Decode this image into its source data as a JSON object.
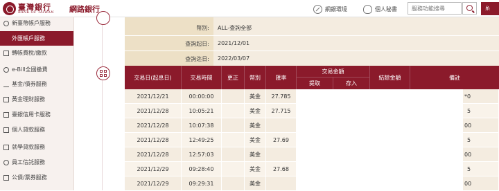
{
  "header": {
    "logo_zh": "臺灣銀行",
    "logo_en": "BANK OF TAIWAN",
    "site_title": "網路銀行",
    "env_label": "網銀環境",
    "secretary_label": "個人秘書",
    "search_placeholder": "服務功能搜尋",
    "logout_label": "糸"
  },
  "sidebar": {
    "items": [
      {
        "label": "新臺幣帳戶服務",
        "icon": "coin-icon"
      },
      {
        "label": "外匯帳戶服務",
        "icon": "",
        "active": true
      },
      {
        "label": "轉帳費稅/繳款",
        "icon": "transfer-icon"
      },
      {
        "label": "e-Bill全國繳費",
        "icon": "bill-icon"
      },
      {
        "label": "基金/債券服務",
        "icon": "chart-icon"
      },
      {
        "label": "黃金理財服務",
        "icon": "gold-icon"
      },
      {
        "label": "臺銀信用卡服務",
        "icon": "card-icon"
      },
      {
        "label": "個人貸款服務",
        "icon": "loan-icon"
      },
      {
        "label": "就學貸款服務",
        "icon": "student-loan-icon"
      },
      {
        "label": "員工信託服務",
        "icon": "trust-icon"
      },
      {
        "label": "公債/票券服務",
        "icon": "bond-icon"
      }
    ]
  },
  "query": {
    "currency_label": "幣別:",
    "currency_value": "ALL-查詢全部",
    "start_label": "查詢起日:",
    "start_value": "2021/12/01",
    "end_label": "查詢迄日:",
    "end_value": "2022/03/07"
  },
  "table": {
    "headers": {
      "date": "交易日(起息日)",
      "time": "交易時間",
      "correction": "更正",
      "currency": "幣別",
      "rate": "匯率",
      "amount": "交易金額",
      "withdraw": "提取",
      "deposit": "存入",
      "balance": "結餘金額",
      "note": "備註"
    },
    "rows": [
      {
        "date": "2021/12/21",
        "time": "00:00:00",
        "correction": "",
        "currency": "美金",
        "rate": "27.785",
        "note_tail": "*0"
      },
      {
        "date": "2021/12/28",
        "time": "10:05:21",
        "correction": "",
        "currency": "美金",
        "rate": "27.715",
        "note_tail": "5"
      },
      {
        "date": "2021/12/28",
        "time": "10:07:38",
        "correction": "",
        "currency": "美金",
        "rate": "",
        "note_tail": "00"
      },
      {
        "date": "2021/12/28",
        "time": "12:49:25",
        "correction": "",
        "currency": "美金",
        "rate": "27.69",
        "note_tail": "5"
      },
      {
        "date": "2021/12/28",
        "time": "12:57:03",
        "correction": "",
        "currency": "美金",
        "rate": "",
        "note_tail": "00"
      },
      {
        "date": "2021/12/29",
        "time": "09:28:40",
        "correction": "",
        "currency": "美金",
        "rate": "27.68",
        "note_tail": "5"
      },
      {
        "date": "2021/12/29",
        "time": "09:29:31",
        "correction": "",
        "currency": "美金",
        "rate": "",
        "note_tail": "00"
      }
    ]
  }
}
